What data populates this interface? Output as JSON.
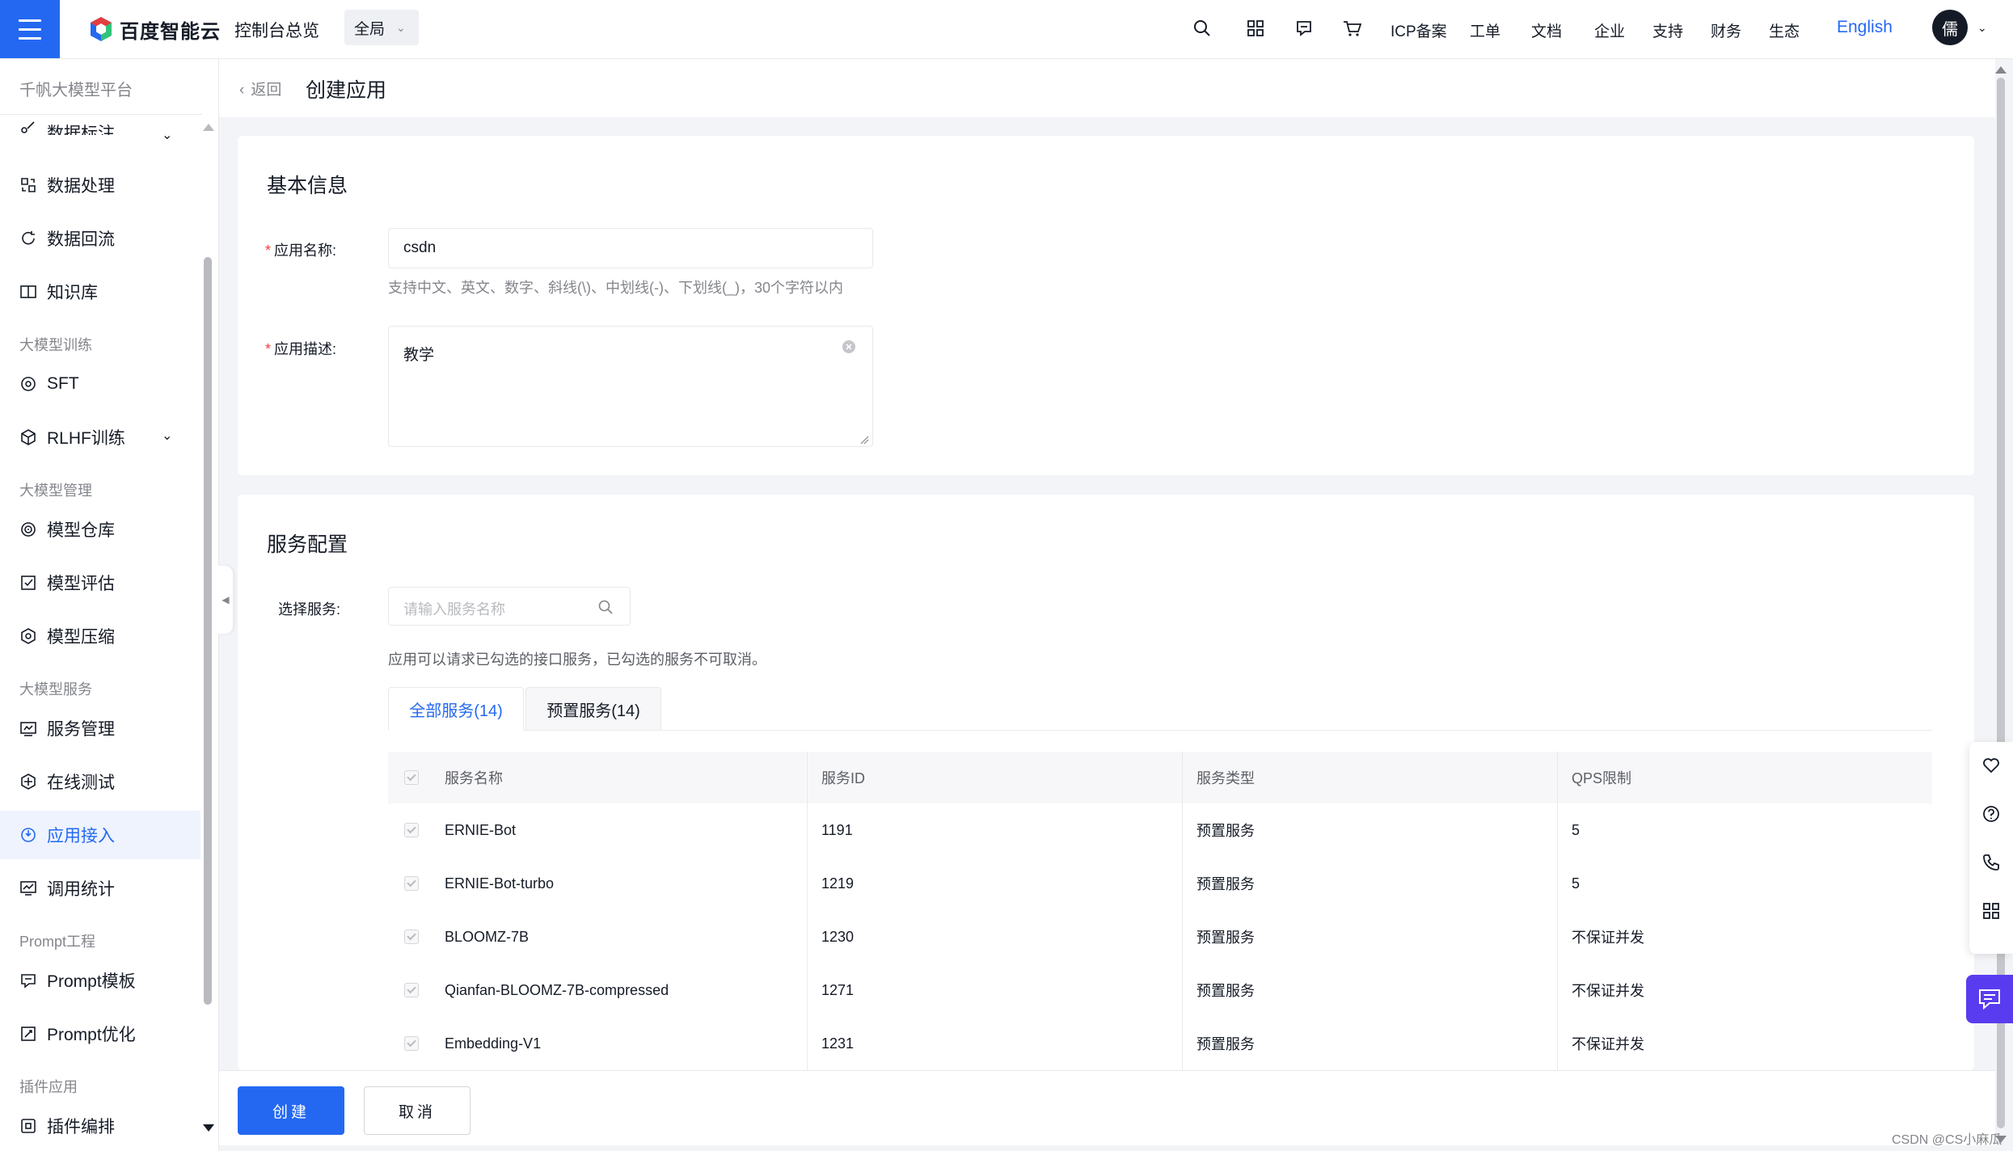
{
  "topbar": {
    "brand": "百度智能云",
    "console": "控制台总览",
    "region": "全局",
    "nav": [
      "ICP备案",
      "工单",
      "文档",
      "企业",
      "支持",
      "财务",
      "生态"
    ],
    "language": "English",
    "avatar_char": "儒"
  },
  "sidebar": {
    "platform": "千帆大模型平台",
    "items_top": [
      "数据标注",
      "数据处理",
      "数据回流",
      "知识库"
    ],
    "group_training": "大模型训练",
    "items_training": [
      "SFT",
      "RLHF训练"
    ],
    "group_manage": "大模型管理",
    "items_manage": [
      "模型仓库",
      "模型评估",
      "模型压缩"
    ],
    "group_service": "大模型服务",
    "items_service": [
      "服务管理",
      "在线测试",
      "应用接入",
      "调用统计"
    ],
    "group_prompt": "Prompt工程",
    "items_prompt": [
      "Prompt模板",
      "Prompt优化"
    ],
    "group_plugin": "插件应用",
    "items_plugin": [
      "插件编排"
    ],
    "active": "应用接入"
  },
  "page": {
    "back": "返回",
    "title": "创建应用"
  },
  "basic": {
    "title": "基本信息",
    "name_label": "应用名称:",
    "name_value": "csdn",
    "name_hint": "支持中文、英文、数字、斜线(\\)、中划线(-)、下划线(_)，30个字符以内",
    "desc_label": "应用描述:",
    "desc_value": "教学"
  },
  "service": {
    "title": "服务配置",
    "select_label": "选择服务:",
    "search_placeholder": "请输入服务名称",
    "note": "应用可以请求已勾选的接口服务，已勾选的服务不可取消。",
    "tabs": [
      "全部服务(14)",
      "预置服务(14)"
    ],
    "columns": [
      "服务名称",
      "服务ID",
      "服务类型",
      "QPS限制"
    ],
    "rows": [
      [
        "ERNIE-Bot",
        "1191",
        "预置服务",
        "5"
      ],
      [
        "ERNIE-Bot-turbo",
        "1219",
        "预置服务",
        "5"
      ],
      [
        "BLOOMZ-7B",
        "1230",
        "预置服务",
        "不保证并发"
      ],
      [
        "Qianfan-BLOOMZ-7B-compressed",
        "1271",
        "预置服务",
        "不保证并发"
      ],
      [
        "Embedding-V1",
        "1231",
        "预置服务",
        "不保证并发"
      ]
    ]
  },
  "actions": {
    "create": "创建",
    "cancel": "取消"
  },
  "watermark": "CSDN @CS小麻瓜",
  "colors": {
    "primary": "#2468f2",
    "chat_button": "#5a3cf0",
    "required": "#f33e3e"
  }
}
